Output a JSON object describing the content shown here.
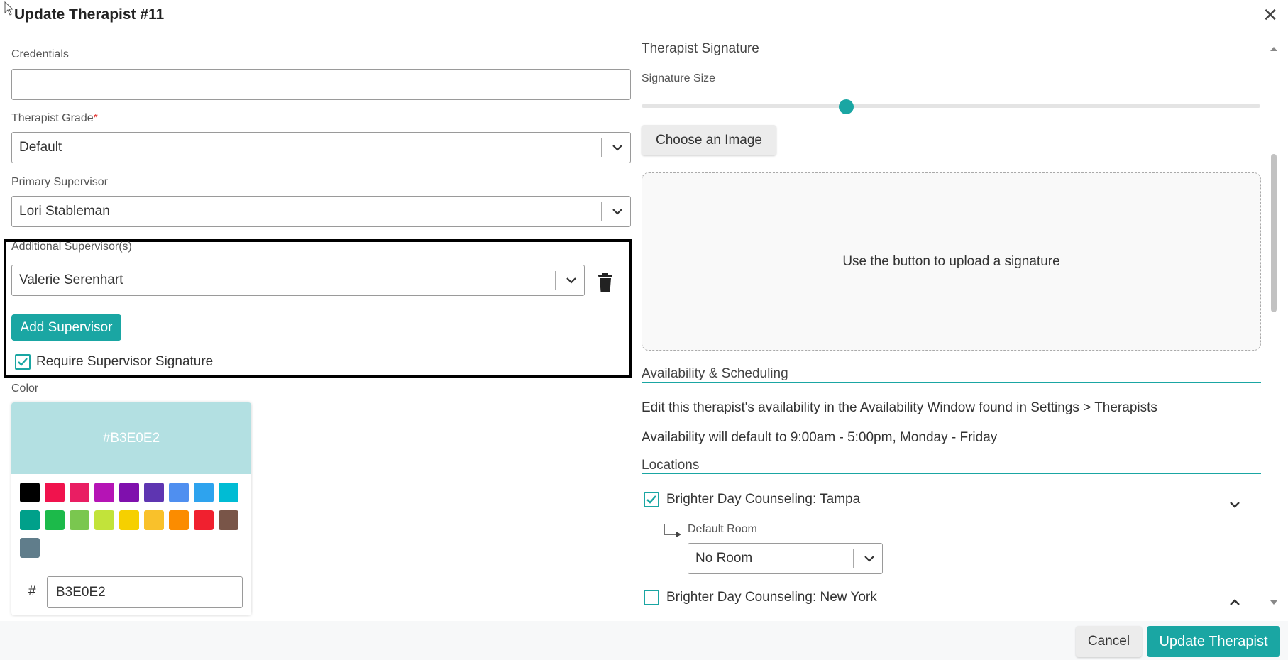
{
  "modal": {
    "title": "Update Therapist #11",
    "close_glyph": "✕"
  },
  "left": {
    "credentials": {
      "label": "Credentials",
      "value": ""
    },
    "therapist_grade": {
      "label": "Therapist Grade",
      "required_mark": "*",
      "value": "Default"
    },
    "primary_supervisor": {
      "label": "Primary Supervisor",
      "value": "Lori Stableman"
    },
    "additional_supervisors": {
      "label": "Additional Supervisor(s)",
      "value": "Valerie Serenhart",
      "add_button": "Add Supervisor",
      "require_signature_label": "Require Supervisor Signature",
      "require_signature_checked": true
    },
    "color": {
      "label": "Color",
      "preview_text": "#B3E0E2",
      "preview_color": "#B3E0E2",
      "hash": "#",
      "hex_value": "B3E0E2",
      "swatches": [
        "#000000",
        "#f0134d",
        "#e91e63",
        "#b514b5",
        "#7f10ad",
        "#5e35b1",
        "#4f8ff0",
        "#2ea3ee",
        "#00bcd4",
        "#00a08a",
        "#1cba4a",
        "#7ac74f",
        "#c2e33a",
        "#f6d000",
        "#f9c12b",
        "#fb8c00",
        "#f0202f",
        "#795548",
        "#607d8b"
      ]
    }
  },
  "right": {
    "signature": {
      "section_title": "Therapist Signature",
      "size_label": "Signature Size",
      "size_value": 0.33,
      "choose_button": "Choose an Image",
      "dropzone_text": "Use the button to upload a signature"
    },
    "availability": {
      "section_title": "Availability & Scheduling",
      "line1": "Edit this therapist's availability in the Availability Window found in Settings > Therapists",
      "line2": "Availability will default to 9:00am - 5:00pm, Monday - Friday"
    },
    "locations": {
      "section_title": "Locations",
      "items": [
        {
          "name": "Brighter Day Counseling: Tampa",
          "checked": true,
          "room_label": "Default Room",
          "room_value": "No Room"
        },
        {
          "name": "Brighter Day Counseling: New York",
          "checked": false
        }
      ]
    }
  },
  "footer": {
    "cancel": "Cancel",
    "submit": "Update Therapist"
  },
  "colors": {
    "accent": "#1aa6a3"
  }
}
